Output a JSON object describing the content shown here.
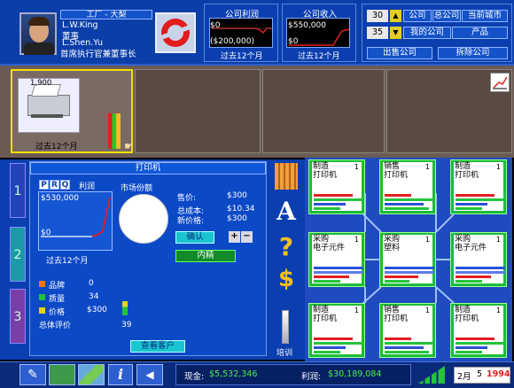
{
  "header": {
    "location_tab": "工厂 - 大梨",
    "ceo_name": "L.W.King",
    "ceo_role1": "董事",
    "ceo_name2": "L.Shen.Yu",
    "ceo_title": "首席执行官兼董事长"
  },
  "profit_chart": {
    "title": "公司利润",
    "top": "$0",
    "bottom": "($200,000)",
    "period": "过去12个月"
  },
  "income_chart": {
    "title": "公司收入",
    "top": "$550,000",
    "bottom": "$0",
    "period": "过去12个月"
  },
  "nav": {
    "num1": "30",
    "num2": "35",
    "company": "公司",
    "corp": "总公司",
    "city": "当前城市",
    "my_company": "我的公司",
    "products": "产品",
    "sell": "出售公司",
    "demolish": "拆除公司"
  },
  "slot1": {
    "value": "1,900",
    "period": "过去12个月"
  },
  "product": {
    "tab": "打印机",
    "profit_label": "利润",
    "profit_top": "$530,000",
    "profit_bottom": "$0",
    "profit_period": "过去12个月",
    "market_share": "市场份额",
    "price_label": "售价:",
    "price": "$300",
    "cost_label": "总成本:",
    "cost": "$10.34",
    "new_price_label": "新价格:",
    "new_price": "$300",
    "confirm": "确认",
    "detail": "内精",
    "brand_label": "品牌",
    "brand": "0",
    "quality_label": "质量",
    "quality": "34",
    "price2_label": "价格",
    "price2": "$300",
    "overall_label": "总体评价",
    "overall": "39",
    "customers": "查看客户",
    "train": "培训",
    "tabs": [
      "1",
      "2",
      "3"
    ]
  },
  "units": [
    {
      "t1": "制造",
      "t2": "打印机",
      "n": "1"
    },
    {
      "t1": "销售",
      "t2": "打印机",
      "n": "1"
    },
    {
      "t1": "制造",
      "t2": "打印机",
      "n": "1"
    },
    {
      "t1": "采购",
      "t2": "电子元件",
      "n": "1"
    },
    {
      "t1": "采购",
      "t2": "塑料",
      "n": "1"
    },
    {
      "t1": "采购",
      "t2": "电子元件",
      "n": "1"
    },
    {
      "t1": "制造",
      "t2": "打印机",
      "n": "1"
    },
    {
      "t1": "销售",
      "t2": "打印机",
      "n": "1"
    },
    {
      "t1": "制造",
      "t2": "打印机",
      "n": "1"
    }
  ],
  "status": {
    "cash_label": "现金:",
    "cash": "$5,532,346",
    "profit_label": "利润:",
    "profit": "$30,189,084",
    "month": "2月",
    "day": "5",
    "year": "1994"
  },
  "colors": {
    "panel": "#0b3fb0",
    "card": "#1dbb3a",
    "accent_red": "#e02020"
  }
}
